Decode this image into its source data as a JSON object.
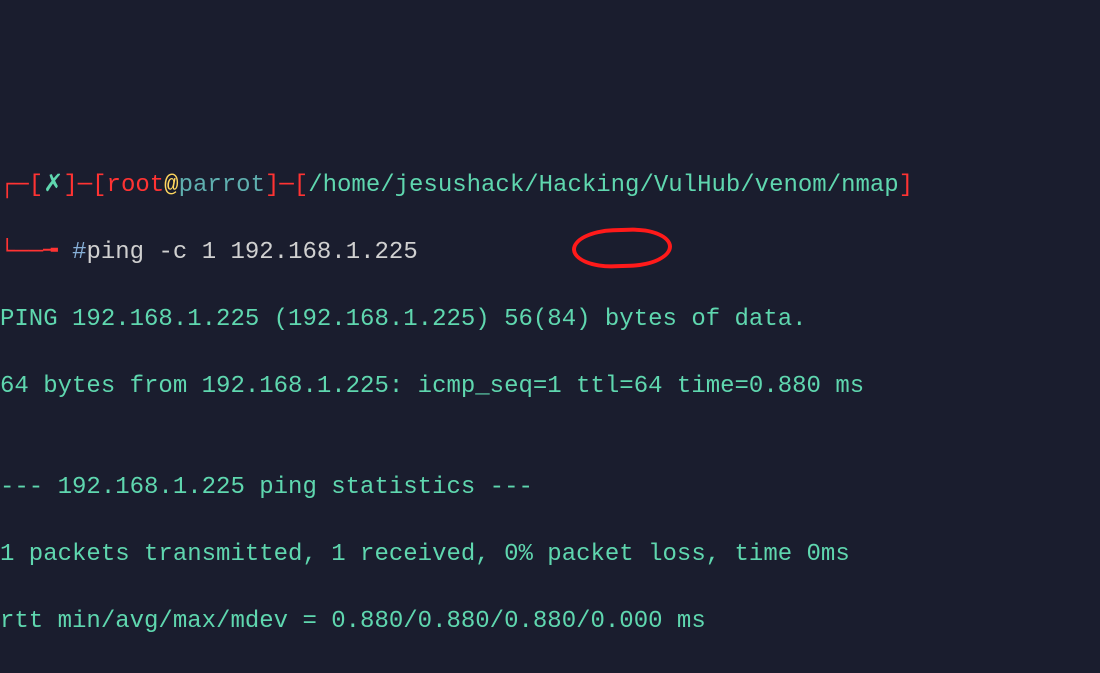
{
  "prompt": {
    "prefix1": "┌─[",
    "x_symbol": "✗",
    "prefix2": "]─[",
    "user": "root",
    "at": "@",
    "host": "parrot",
    "prefix3": "]─[",
    "path": "/home/jesushack/Hacking/VulHub/venom/nmap",
    "prefix4": "]",
    "line2_prefix": "└──╼ ",
    "hash": "#",
    "command": "ping -c 1 192.168.1.225"
  },
  "output": {
    "line1": "PING 192.168.1.225 (192.168.1.225) 56(84) bytes of data.",
    "line2_before": "64 bytes from 192.168.1.225: icmp_seq=1 ",
    "line2_highlight": "ttl=64",
    "line2_after": " time=0.880 ms",
    "blank": "",
    "line3": "--- 192.168.1.225 ping statistics ---",
    "line4": "1 packets transmitted, 1 received, 0% packet loss, time 0ms",
    "line5": "rtt min/avg/max/mdev = 0.880/0.880/0.880/0.000 ms"
  }
}
